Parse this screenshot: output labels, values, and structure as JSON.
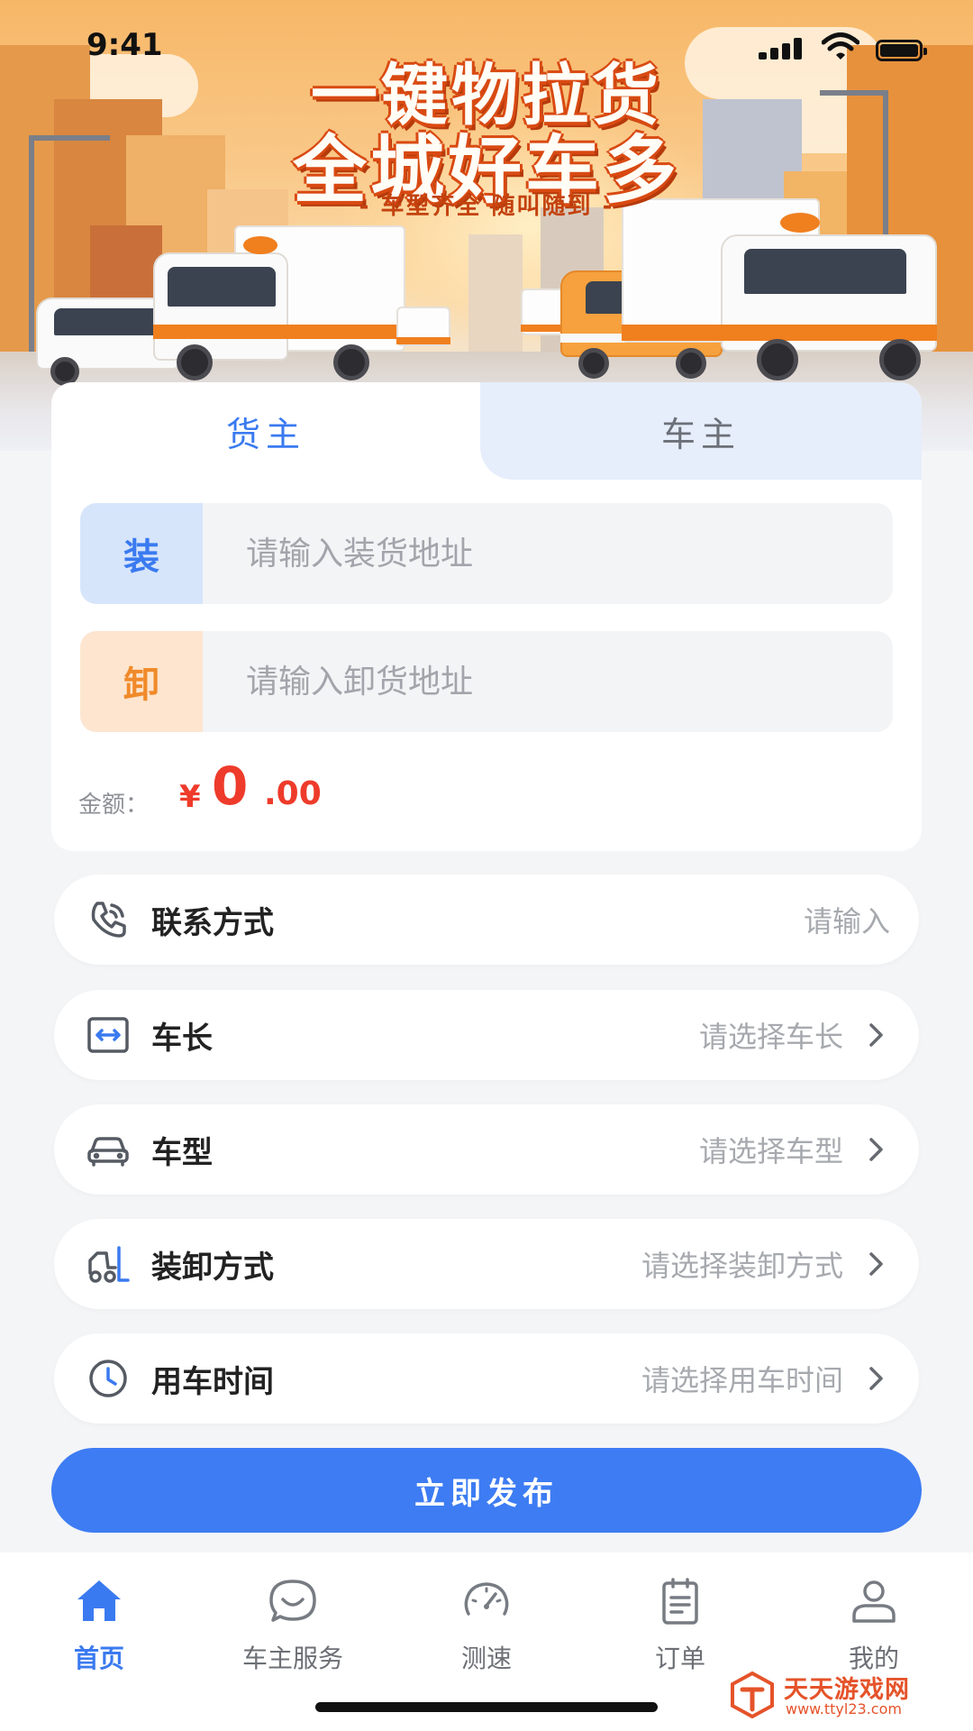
{
  "status_bar": {
    "time": "9:41"
  },
  "banner": {
    "headline_line1": "一键物拉货",
    "headline_line2": "全城好车多",
    "tagline": "- 车型齐全 随叫随到 -"
  },
  "form": {
    "tabs": [
      {
        "label": "货主",
        "active": true
      },
      {
        "label": "车主",
        "active": false
      }
    ],
    "load": {
      "badge": "装",
      "placeholder": "请输入装货地址",
      "value": ""
    },
    "unload": {
      "badge": "卸",
      "placeholder": "请输入卸货地址",
      "value": ""
    },
    "amount": {
      "label": "金额：",
      "symbol": "¥",
      "integer": "0",
      "decimal": ".00"
    }
  },
  "options": [
    {
      "icon": "phone-icon",
      "label": "联系方式",
      "value": "请输入",
      "arrow": false
    },
    {
      "icon": "length-icon",
      "label": "车长",
      "value": "请选择车长",
      "arrow": true
    },
    {
      "icon": "car-icon",
      "label": "车型",
      "value": "请选择车型",
      "arrow": true
    },
    {
      "icon": "forklift-icon",
      "label": "装卸方式",
      "value": "请选择装卸方式",
      "arrow": true
    },
    {
      "icon": "clock-icon",
      "label": "用车时间",
      "value": "请选择用车时间",
      "arrow": true
    }
  ],
  "publish_label": "立即发布",
  "tabbar": [
    {
      "icon": "home-icon",
      "label": "首页",
      "active": true
    },
    {
      "icon": "chat-icon",
      "label": "车主服务",
      "active": false
    },
    {
      "icon": "speedometer-icon",
      "label": "测速",
      "active": false
    },
    {
      "icon": "clipboard-icon",
      "label": "订单",
      "active": false
    },
    {
      "icon": "profile-icon",
      "label": "我的",
      "active": false
    }
  ],
  "watermark": {
    "title": "天天游戏网",
    "url": "www.ttyl23.com"
  },
  "colors": {
    "primary": "#3d7cf3",
    "accent_orange": "#f08a2a",
    "amount_red": "#ee3b2b",
    "background": "#f4f5f7"
  }
}
